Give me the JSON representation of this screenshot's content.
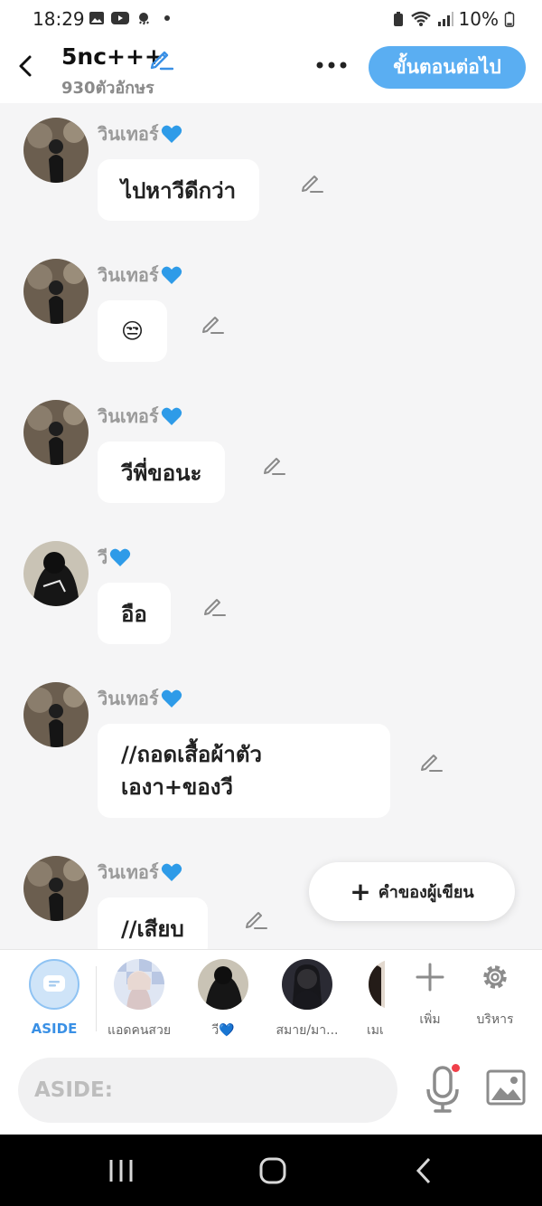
{
  "status_bar": {
    "time": "18:29",
    "battery": "10%",
    "icons": [
      "gallery-icon",
      "youtube-icon",
      "weather-icon",
      "dot-icon",
      "lock-battery-icon",
      "wifi-icon",
      "signal-icon",
      "battery-icon"
    ]
  },
  "header": {
    "title": "5nc+++",
    "subtitle": "930ตัวอักษร",
    "next_label": "ขั้นตอนต่อไป"
  },
  "messages": [
    {
      "name": "วินเทอร์",
      "text": "ไปหาวีดีกว่า",
      "avatar": "winter"
    },
    {
      "name": "วินเทอร์",
      "text": "😒",
      "avatar": "winter"
    },
    {
      "name": "วินเทอร์",
      "text": "วีพี่ขอนะ",
      "avatar": "winter"
    },
    {
      "name": "วี",
      "text": "อือ",
      "avatar": "v"
    },
    {
      "name": "วินเทอร์",
      "text_lines": [
        "//ถอดเสื้อผ้าตัว",
        "เองา+ของวี"
      ],
      "avatar": "winter"
    },
    {
      "name": "วินเทอร์",
      "text": "//เสียบ",
      "avatar": "winter"
    }
  ],
  "fab": {
    "label": "คำของผู้เขียน"
  },
  "characters": [
    {
      "label": "ASIDE"
    },
    {
      "label": "แอดคนสวย"
    },
    {
      "label": "วี💙"
    },
    {
      "label": "สมาย/มา..."
    },
    {
      "label": "เมเ"
    }
  ],
  "tools": {
    "add_label": "เพิ่ม",
    "manage_label": "บริหาร"
  },
  "input": {
    "placeholder": "ASIDE:"
  },
  "colors": {
    "accent": "#5aaef2",
    "heart": "#2e9be8",
    "aside_label": "#3a90e5",
    "mic_dot": "#f0404a"
  }
}
